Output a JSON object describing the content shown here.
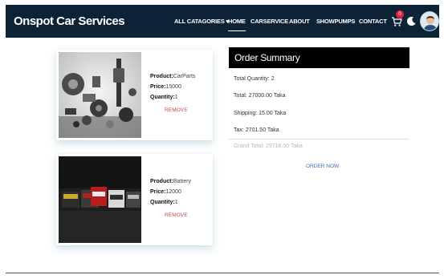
{
  "nav": {
    "brand": "Onspot Car Services",
    "links": [
      {
        "label": "ALL CATAGORIES ▾"
      },
      {
        "label": "HOME"
      },
      {
        "label": "CARSERVICE"
      },
      {
        "label": "ABOUT"
      },
      {
        "label": "SHOWPUMPS"
      },
      {
        "label": "CONTACT"
      }
    ],
    "cart_count": "0"
  },
  "cart_items": [
    {
      "product_label": "Product:",
      "product": "CarParts",
      "price_label": "Price:",
      "price": "15000",
      "quantity_label": "Quantity:",
      "quantity": "1",
      "remove_label": "REMOVE"
    },
    {
      "product_label": "Product:",
      "product": "Battery",
      "price_label": "Price:",
      "price": "12000",
      "quantity_label": "Quantity:",
      "quantity": "1",
      "remove_label": "REMOVE"
    }
  ],
  "summary": {
    "title": "Order Summary",
    "total_quantity": "Total Quantity: 2",
    "total": "Total: 27000.00 Taka",
    "shipping": "Shipping: 15.00 Taka",
    "tax": "Tax: 2701.50 Taka",
    "grand_total": "Grand Total: 29716.50 Taka",
    "order_button": "ORDER NOW"
  },
  "colors": {
    "navbar": "#0c2236",
    "summary_header": "#000000",
    "remove": "#d04444",
    "order_now": "#3a6fb5",
    "badge": "#e0213a"
  }
}
